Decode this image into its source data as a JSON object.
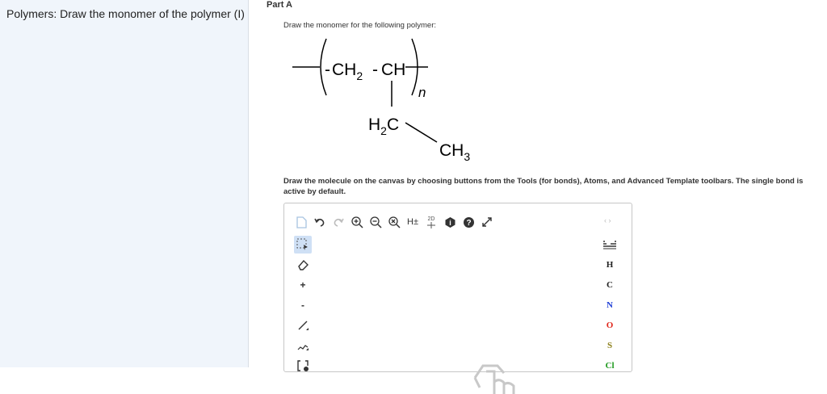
{
  "question": {
    "title": "Polymers: Draw the monomer of the polymer (I)"
  },
  "part": {
    "label": "Part A"
  },
  "prompt": "Draw the monomer for the following polymer:",
  "structure": {
    "ch2": "CH",
    "ch2_sub": "2",
    "ch": "CH",
    "n": "n",
    "h2c_h": "H",
    "h2c_sub": "2",
    "h2c_c": "C",
    "ch3": "CH",
    "ch3_sub": "3"
  },
  "instructions": "Draw the molecule on the canvas by choosing buttons from the Tools (for bonds), Atoms, and Advanced Template toolbars. The single bond is active by default.",
  "editor": {
    "top_toolbar": {
      "hydrogen_label": "H±",
      "two_d_label": "2D"
    },
    "left_toolbar": {
      "plus_label": "+",
      "minus_label": "-"
    },
    "atoms": [
      {
        "symbol": "H",
        "color": "#222222"
      },
      {
        "symbol": "C",
        "color": "#222222"
      },
      {
        "symbol": "N",
        "color": "#1f3fd6"
      },
      {
        "symbol": "O",
        "color": "#e0261b"
      },
      {
        "symbol": "S",
        "color": "#8a7d15"
      },
      {
        "symbol": "Cl",
        "color": "#1f9a1f"
      }
    ],
    "nav_arrows": "‹ ›"
  }
}
